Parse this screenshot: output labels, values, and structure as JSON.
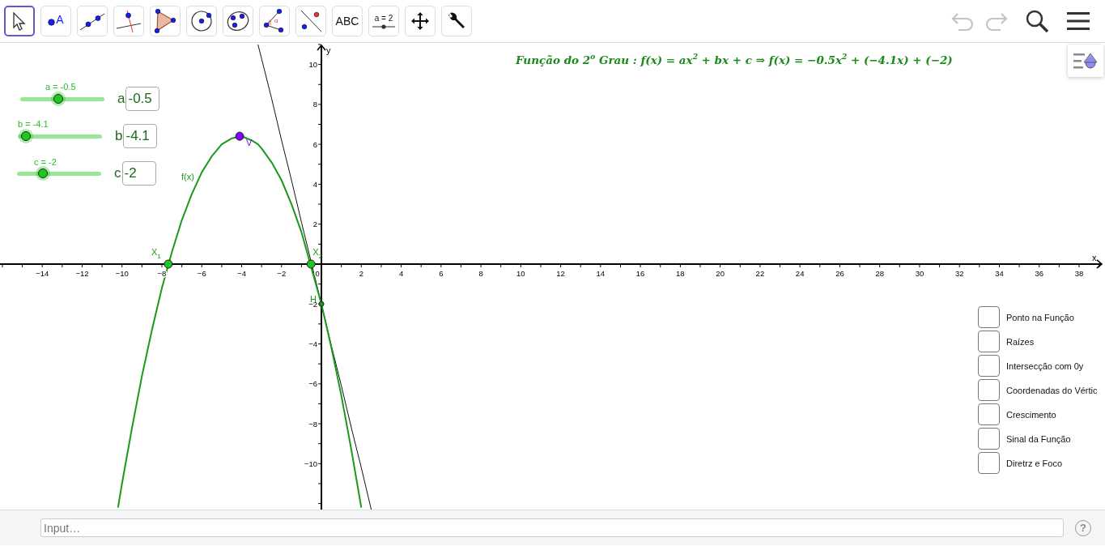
{
  "toolbar": {
    "tools": [
      {
        "kind": "move",
        "selected": true
      },
      {
        "kind": "point",
        "selected": false,
        "label": "A"
      },
      {
        "kind": "line",
        "selected": false
      },
      {
        "kind": "perpendicular",
        "selected": false
      },
      {
        "kind": "polygon",
        "selected": false
      },
      {
        "kind": "circle",
        "selected": false
      },
      {
        "kind": "conic",
        "selected": false
      },
      {
        "kind": "angle",
        "selected": false,
        "label": "α"
      },
      {
        "kind": "reflect",
        "selected": false
      },
      {
        "kind": "text",
        "selected": false,
        "label": "ABC"
      },
      {
        "kind": "slider",
        "selected": false,
        "label": "a = 2"
      },
      {
        "kind": "pan",
        "selected": false
      },
      {
        "kind": "tools",
        "selected": false
      }
    ],
    "undo": {
      "disabled": true
    },
    "redo": {
      "disabled": true
    }
  },
  "formula": "Função do 2$^{o}$ Grau : f(x) = ax$^{2}$ + bx + c ⇒ f(x) = −0.5x$^{2}$ + (−4.1x) + (−2)",
  "sliders": [
    {
      "caption": "a = -0.5",
      "level": 0.45,
      "input_label": "a",
      "value": "-0.5"
    },
    {
      "caption": "b = -4.1",
      "level": 0.1,
      "input_label": "b",
      "value": "-4.1"
    },
    {
      "caption": "c = -2",
      "level": 0.31,
      "input_label": "c",
      "value": "-2"
    }
  ],
  "graph": {
    "chart_data": {
      "type": "line",
      "xlabel": "x",
      "ylabel": "y",
      "x": [
        -10.2,
        -10,
        -9.5,
        -9,
        -8.5,
        -8,
        -7.5,
        -7,
        -6.5,
        -6,
        -5.5,
        -5,
        -4.5,
        -4,
        -3.5,
        -3.18,
        -3,
        -2.5,
        -2,
        -1.5,
        -1,
        0,
        0.5,
        1,
        1.5,
        2,
        2.5
      ],
      "series": [
        {
          "name": "f(x)",
          "color": "#1a9a1a",
          "values": [
            -12.2,
            -11,
            -8.2,
            -5.6,
            -3.3,
            -1.2,
            0.6,
            2.2,
            3.5,
            4.6,
            5.4,
            6,
            6.3,
            6.4,
            6.2,
            6,
            5.8,
            5.1,
            4.2,
            3,
            1.6,
            -2,
            -4.2,
            -6.6,
            -9.3,
            -12.2,
            null
          ]
        },
        {
          "color": "#111111",
          "values": [
            null,
            null,
            null,
            null,
            null,
            null,
            null,
            null,
            null,
            null,
            null,
            null,
            null,
            null,
            null,
            11,
            10.3,
            8.3,
            6.2,
            4.2,
            2.1,
            -2,
            -4.1,
            -6.1,
            -8.2,
            -10.2,
            -12.3
          ]
        }
      ],
      "xlim": [
        -16.12,
        39.3
      ],
      "ylim": [
        -12.3,
        11.08
      ],
      "xticks": [
        {
          "value": -14,
          "label": "−14"
        },
        {
          "value": -12,
          "label": "−12"
        },
        {
          "value": -10,
          "label": "−10"
        },
        {
          "value": -8,
          "label": "−8"
        },
        {
          "value": -6,
          "label": "−6"
        },
        {
          "value": -4,
          "label": "−4"
        },
        {
          "value": -2,
          "label": "−2"
        },
        0,
        2,
        4,
        6,
        8,
        10,
        12,
        14,
        16,
        18,
        20,
        22,
        24,
        26,
        28,
        30,
        32,
        34,
        36,
        38
      ],
      "yticks": [
        10,
        8,
        6,
        4,
        2,
        {
          "value": -2,
          "label": "−2"
        },
        {
          "value": -4,
          "label": "−4"
        },
        {
          "value": -6,
          "label": "−6"
        },
        {
          "value": -8,
          "label": "−8"
        },
        {
          "value": -10,
          "label": "−10"
        }
      ]
    },
    "points": [
      {
        "kind": "vertex",
        "label": "V"
      },
      {
        "kind": "root1",
        "label": "X$_{1}$"
      },
      {
        "kind": "root2",
        "label": "X$_{2}$"
      },
      {
        "kind": "intercept",
        "label": "H"
      }
    ]
  },
  "checkboxes": [
    {
      "label": "Ponto na Função",
      "checked": false
    },
    {
      "label": "Raízes",
      "checked": false
    },
    {
      "label": "Intersecção com 0y",
      "checked": false
    },
    {
      "label": "Coordenadas do Vértic",
      "checked": false
    },
    {
      "label": "Crescimento",
      "checked": false
    },
    {
      "label": "Sinal da Função",
      "checked": false
    },
    {
      "label": "Diretrz e Foco",
      "checked": false
    }
  ],
  "input_bar": {
    "placeholder": "Input…",
    "help": "?"
  }
}
